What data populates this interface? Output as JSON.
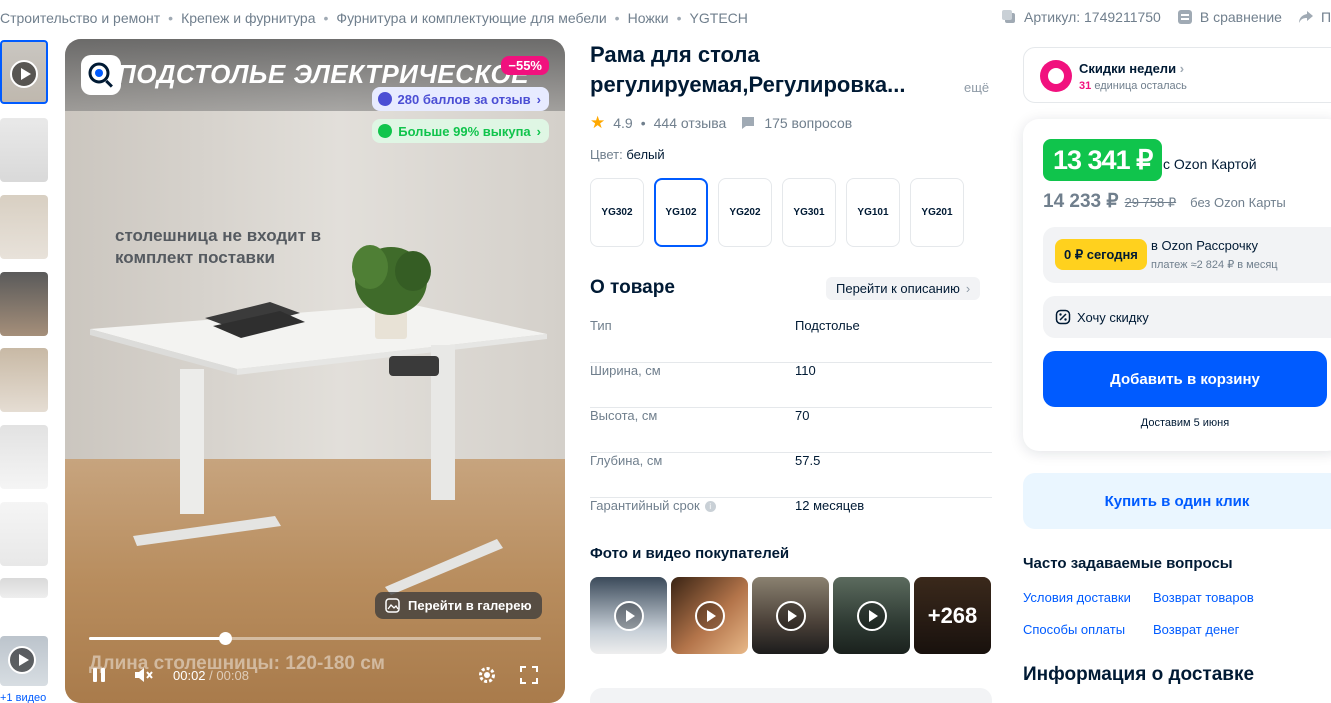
{
  "breadcrumbs": [
    "Строительство и ремонт",
    "Крепеж и фурнитура",
    "Фурнитура и комплектующие для мебели",
    "Ножки",
    "YGTECH"
  ],
  "header_right": {
    "sku": "Артикул: 1749211750",
    "compare": "В сравнение",
    "share": "П"
  },
  "thumbnails": {
    "more_video_label": "+1 видео"
  },
  "media": {
    "headline": "ПОДСТОЛЬЕ ЭЛЕКТРИЧЕСКОЕ",
    "discount_badge": "−55%",
    "points_pill": "280 баллов за отзыв",
    "buyout_pill": "Больше 99% выкупа",
    "caption": "столешница не входит в комплект поставки",
    "overlay_text": "Длина столешницы: 120-180 см",
    "gallery_button": "Перейти в галерею",
    "time_current": "00:02",
    "time_total": "/ 00:08",
    "progress_fraction": 0.3
  },
  "product": {
    "title": "Рама для стола регулируемая,Регулировка...",
    "title_more": "ещё",
    "rating": "4.9",
    "reviews": "444 отзыва",
    "questions": "175 вопросов",
    "color_label": "Цвет:",
    "color_value": "белый",
    "variants": [
      "YG302",
      "YG102",
      "YG202",
      "YG301",
      "YG101",
      "YG201"
    ],
    "selected_variant_index": 1
  },
  "about": {
    "title": "О товаре",
    "to_description": "Перейти к описанию",
    "specs": [
      {
        "key": "Тип",
        "value": "Подстолье"
      },
      {
        "key": "Ширина, см",
        "value": "110"
      },
      {
        "key": "Высота, см",
        "value": "70"
      },
      {
        "key": "Глубина, см",
        "value": "57.5"
      },
      {
        "key": "Гарантийный срок",
        "value": "12 месяцев"
      }
    ]
  },
  "ugc": {
    "title": "Фото и видео покупателей",
    "more_count": "+268"
  },
  "week_deals": {
    "title": "Скидки недели",
    "count": "31",
    "subtitle": "единица осталась"
  },
  "price": {
    "card_price": "13 341 ₽",
    "card_label": "с Ozon Картой",
    "regular_price": "14 233 ₽",
    "old_price": "29 758 ₽",
    "no_card_label": "без Ozon Карты",
    "installment_badge": "0 ₽ сегодня",
    "installment_title": "в Ozon Рассрочку",
    "installment_sub": "платеж ≈2 824 ₽ в месяц",
    "want_discount": "Хочу скидку",
    "add_to_cart": "Добавить в корзину",
    "delivery": "Доставим 5 июня"
  },
  "one_click": "Купить в один клик",
  "faq": {
    "title": "Часто задаваемые вопросы",
    "links": [
      "Условия доставки",
      "Возврат товаров",
      "Способы оплаты",
      "Возврат денег"
    ]
  },
  "delivery_info_title": "Информация о доставке",
  "colors": {
    "accent": "#005bff",
    "green": "#10c44c",
    "pink": "#f1117e",
    "yellow": "#ffd11e"
  }
}
